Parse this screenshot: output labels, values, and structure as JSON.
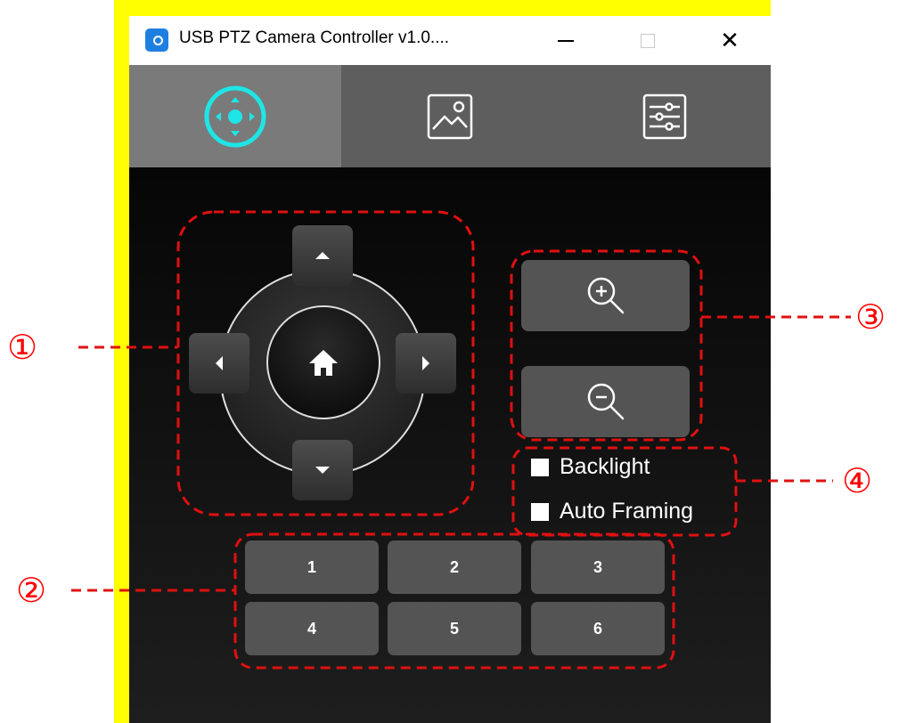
{
  "window": {
    "title": "USB PTZ Camera Controller v1.0....",
    "minimize_label": "—",
    "close_label": "✕"
  },
  "tabs": [
    {
      "icon": "ptz-control-icon",
      "active": true
    },
    {
      "icon": "image-icon",
      "active": false
    },
    {
      "icon": "settings-sliders-icon",
      "active": false
    }
  ],
  "dpad": {
    "up": "up-arrow-icon",
    "down": "down-arrow-icon",
    "left": "left-arrow-icon",
    "right": "right-arrow-icon",
    "home": "home-icon"
  },
  "zoom": {
    "in": "zoom-in-icon",
    "out": "zoom-out-icon"
  },
  "checkboxes": [
    {
      "label": "Backlight",
      "checked": false
    },
    {
      "label": "Auto Framing",
      "checked": false
    }
  ],
  "presets": [
    "1",
    "2",
    "3",
    "4",
    "5",
    "6"
  ],
  "callouts": [
    "①",
    "②",
    "③",
    "④"
  ],
  "colors": {
    "accent": "#1ee6e6",
    "callout": "#ff0000",
    "highlight": "#ffff00"
  }
}
